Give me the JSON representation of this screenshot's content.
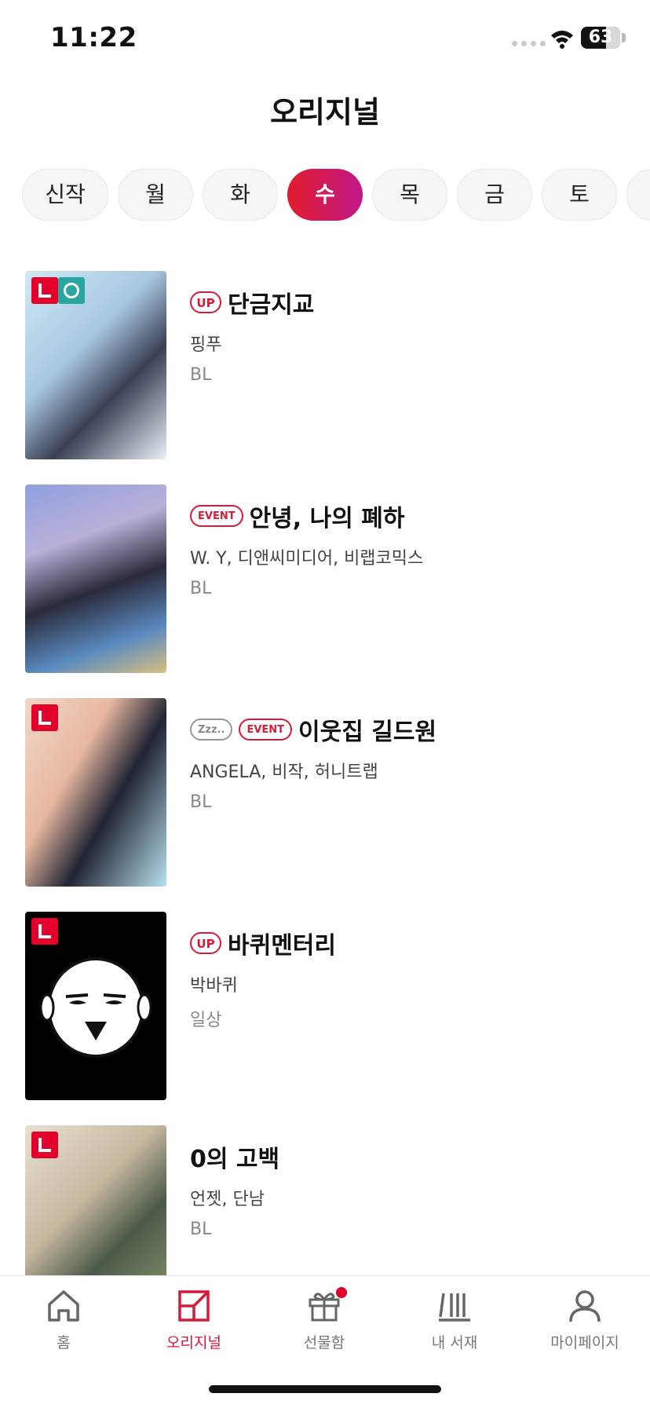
{
  "status": {
    "time": "11:22",
    "battery": "63"
  },
  "header": {
    "title": "오리지널"
  },
  "tabs": [
    {
      "label": "신작",
      "active": false
    },
    {
      "label": "월",
      "active": false
    },
    {
      "label": "화",
      "active": false
    },
    {
      "label": "수",
      "active": true
    },
    {
      "label": "목",
      "active": false
    },
    {
      "label": "금",
      "active": false
    },
    {
      "label": "토",
      "active": false
    }
  ],
  "items": [
    {
      "tags": [
        "UP"
      ],
      "title": "단금지교",
      "author": "핑푸",
      "genre": "BL"
    },
    {
      "tags": [
        "EVENT"
      ],
      "title": "안녕, 나의 폐하",
      "author": "W. Y, 디앤씨미디어, 비랩코믹스",
      "genre": "BL"
    },
    {
      "tags": [
        "Zzz..",
        "EVENT"
      ],
      "title": "이웃집 길드원",
      "author": "ANGELA, 비작, 허니트랩",
      "genre": "BL"
    },
    {
      "tags": [
        "UP"
      ],
      "title": "바퀴멘터리",
      "author": "박바퀴",
      "genre": "일상"
    },
    {
      "tags": [],
      "title": "0의 고백",
      "author": "언젯, 단남",
      "genre": "BL"
    }
  ],
  "bottom_nav": [
    {
      "label": "홈",
      "icon": "home-icon"
    },
    {
      "label": "오리지널",
      "icon": "originals-icon",
      "active": true
    },
    {
      "label": "선물함",
      "icon": "gift-icon"
    },
    {
      "label": "내 서재",
      "icon": "library-icon"
    },
    {
      "label": "마이페이지",
      "icon": "profile-icon"
    }
  ],
  "colors": {
    "accent": "#d8183a",
    "badge_red": "#e3002b",
    "tab_gradient_start": "#e01c2c",
    "tab_gradient_end": "#c2188a"
  }
}
